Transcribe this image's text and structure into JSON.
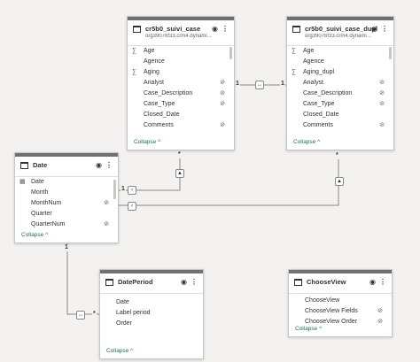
{
  "tables": {
    "suivi_case": {
      "title": "cr5b0_suivi_case",
      "subtitle": "org39076f33.crm4.dynami...",
      "fields": [
        {
          "icon": "sigma-icon",
          "glyph": "∑",
          "label": "Age",
          "hidden": false
        },
        {
          "icon": "",
          "glyph": "",
          "label": "Agence",
          "hidden": false
        },
        {
          "icon": "sigma-icon",
          "glyph": "∑",
          "label": "Aging",
          "hidden": false
        },
        {
          "icon": "",
          "glyph": "",
          "label": "Analyst",
          "hidden": true
        },
        {
          "icon": "",
          "glyph": "",
          "label": "Case_Description",
          "hidden": true
        },
        {
          "icon": "",
          "glyph": "",
          "label": "Case_Type",
          "hidden": true
        },
        {
          "icon": "",
          "glyph": "",
          "label": "Closed_Date",
          "hidden": false
        },
        {
          "icon": "",
          "glyph": "",
          "label": "Comments",
          "hidden": true
        }
      ],
      "collapse": "Collapse ^"
    },
    "suivi_case_dupl": {
      "title": "cr5b0_suivi_case_dupl",
      "subtitle": "org39076f33.crm4.dynami...",
      "fields": [
        {
          "icon": "sigma-icon",
          "glyph": "∑",
          "label": "Age",
          "hidden": false
        },
        {
          "icon": "",
          "glyph": "",
          "label": "Agence",
          "hidden": false
        },
        {
          "icon": "sigma-icon",
          "glyph": "∑",
          "label": "Aging_dupl",
          "hidden": false
        },
        {
          "icon": "",
          "glyph": "",
          "label": "Analyst",
          "hidden": true
        },
        {
          "icon": "",
          "glyph": "",
          "label": "Case_Description",
          "hidden": true
        },
        {
          "icon": "",
          "glyph": "",
          "label": "Case_Type",
          "hidden": true
        },
        {
          "icon": "",
          "glyph": "",
          "label": "Closed_Date",
          "hidden": false
        },
        {
          "icon": "",
          "glyph": "",
          "label": "Comments",
          "hidden": true
        }
      ],
      "collapse": "Collapse ^"
    },
    "date": {
      "title": "Date",
      "fields": [
        {
          "icon": "calendar-icon",
          "glyph": "▦",
          "label": "Date",
          "hidden": false
        },
        {
          "icon": "",
          "glyph": "",
          "label": "Month",
          "hidden": false
        },
        {
          "icon": "",
          "glyph": "",
          "label": "MonthNum",
          "hidden": true
        },
        {
          "icon": "",
          "glyph": "",
          "label": "Quarter",
          "hidden": false
        },
        {
          "icon": "",
          "glyph": "",
          "label": "QuarterNum",
          "hidden": true
        }
      ],
      "collapse": "Collapse ^"
    },
    "dateperiod": {
      "title": "DatePeriod",
      "fields": [
        {
          "icon": "",
          "glyph": "",
          "label": "Date",
          "hidden": false
        },
        {
          "icon": "",
          "glyph": "",
          "label": "Label period",
          "hidden": false
        },
        {
          "icon": "",
          "glyph": "",
          "label": "Order",
          "hidden": false
        }
      ],
      "collapse": "Collapse ^"
    },
    "chooseview": {
      "title": "ChooseView",
      "fields": [
        {
          "icon": "",
          "glyph": "",
          "label": "ChooseView",
          "hidden": false
        },
        {
          "icon": "",
          "glyph": "",
          "label": "ChooseView Fields",
          "hidden": true
        },
        {
          "icon": "",
          "glyph": "",
          "label": "ChooseView Order",
          "hidden": true
        }
      ],
      "collapse": "Collapse ^"
    }
  },
  "relationships": {
    "case_to_dupl": {
      "from_card": "1",
      "to_card": "1"
    },
    "date_to_case": {
      "from_card": "1",
      "to_card": "*"
    },
    "date_to_dupl": {
      "to_card": "*"
    },
    "date_to_dateperiod": {
      "from_card": "1",
      "to_card": "*"
    }
  },
  "icons": {
    "eye": "eye-icon",
    "hidden": "eye-hidden-icon",
    "more": "more-icon"
  },
  "colors": {
    "accent": "#217346",
    "background": "#f3f2f1",
    "card_header": "#707070"
  }
}
